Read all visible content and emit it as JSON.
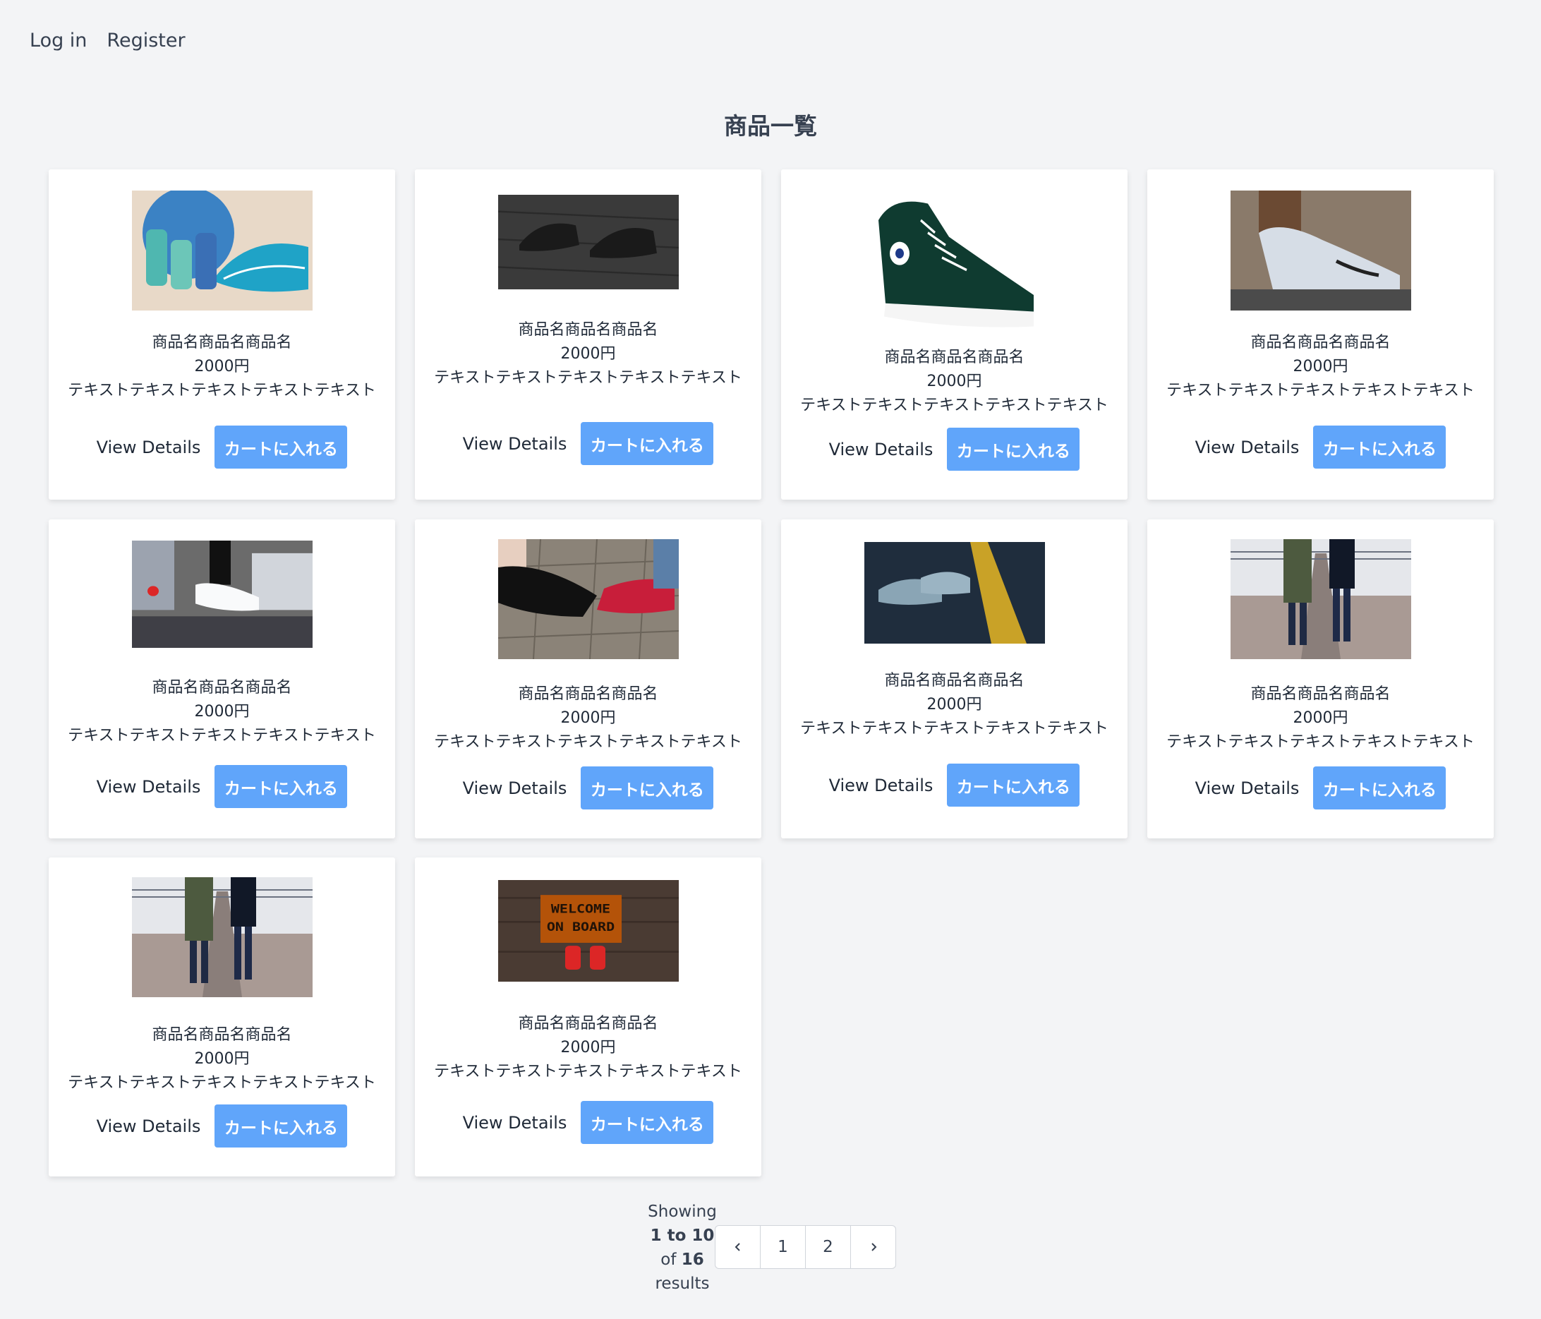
{
  "nav": {
    "login": "Log in",
    "register": "Register"
  },
  "page_title": "商品一覧",
  "products": [
    {
      "name": "商品名商品名商品名",
      "price": "2000円",
      "desc": "テキストテキストテキストテキストテキスト",
      "view": "View Details",
      "cart": "カートに入れる",
      "image": "sneakers-dumbbells-image"
    },
    {
      "name": "商品名商品名商品名",
      "price": "2000円",
      "desc": "テキストテキストテキストテキストテキスト",
      "view": "View Details",
      "cart": "カートに入れる",
      "image": "dark-shoes-on-wood-image"
    },
    {
      "name": "商品名商品名商品名",
      "price": "2000円",
      "desc": "テキストテキストテキストテキストテキスト",
      "view": "View Details",
      "cart": "カートに入れる",
      "image": "green-high-top-sneaker-image"
    },
    {
      "name": "商品名商品名商品名",
      "price": "2000円",
      "desc": "テキストテキストテキストテキストテキスト",
      "view": "View Details",
      "cart": "カートに入れる",
      "image": "white-sneaker-closeup-image"
    },
    {
      "name": "商品名商品名商品名",
      "price": "2000円",
      "desc": "テキストテキストテキストテキストテキスト",
      "view": "View Details",
      "cart": "カートに入れる",
      "image": "white-sneakers-street-image"
    },
    {
      "name": "商品名商品名商品名",
      "price": "2000円",
      "desc": "テキストテキストテキストテキストテキスト",
      "view": "View Details",
      "cart": "カートに入れる",
      "image": "converse-pair-cobblestone-image"
    },
    {
      "name": "商品名商品名商品名",
      "price": "2000円",
      "desc": "テキストテキストテキストテキストテキスト",
      "view": "View Details",
      "cart": "カートに入れる",
      "image": "shoes-on-road-line-image"
    },
    {
      "name": "商品名商品名商品名",
      "price": "2000円",
      "desc": "テキストテキストテキストテキストテキスト",
      "view": "View Details",
      "cart": "カートに入れる",
      "image": "couple-on-pier-image"
    },
    {
      "name": "商品名商品名商品名",
      "price": "2000円",
      "desc": "テキストテキストテキストテキストテキスト",
      "view": "View Details",
      "cart": "カートに入れる",
      "image": "couple-on-pier-image"
    },
    {
      "name": "商品名商品名商品名",
      "price": "2000円",
      "desc": "テキストテキストテキストテキストテキスト",
      "view": "View Details",
      "cart": "カートに入れる",
      "image": "welcome-on-board-mat-image"
    }
  ],
  "pagination": {
    "showing": "Showing",
    "range": "1 to 10",
    "of": "of",
    "total": "16",
    "results": "results",
    "pages": [
      "1",
      "2"
    ],
    "prev_icon": "chevron-left-icon",
    "next_icon": "chevron-right-icon"
  },
  "colors": {
    "background": "#f3f4f6",
    "card": "#ffffff",
    "button": "#60a5fa"
  }
}
